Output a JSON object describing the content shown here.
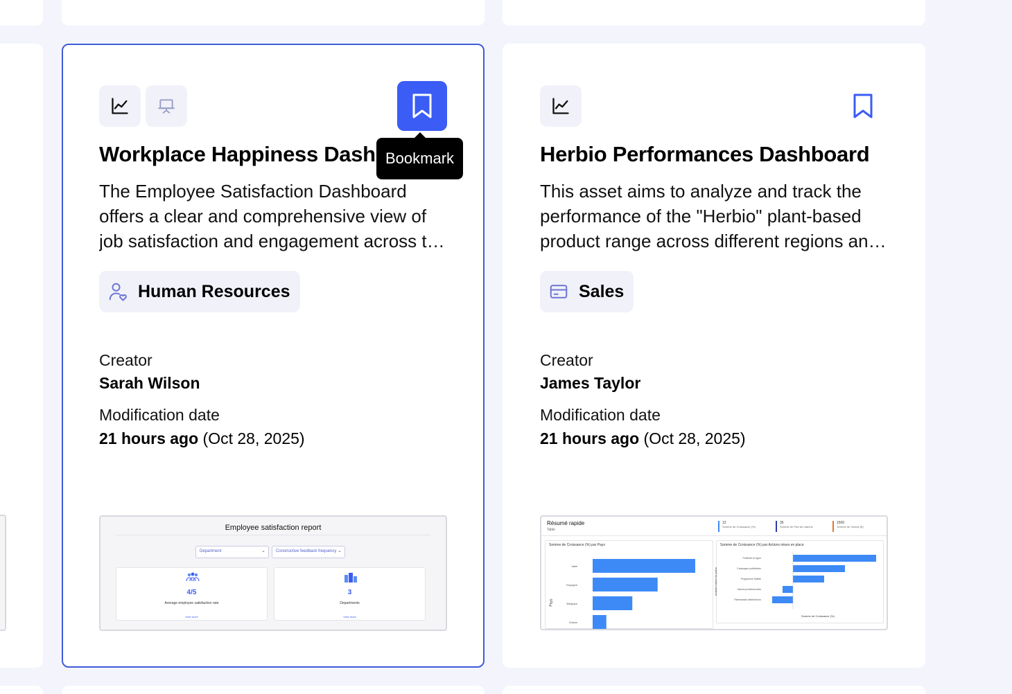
{
  "cards": [
    {
      "title": "Workplace Happiness Dashboard",
      "description": "The Employee Satisfaction Dashboard offers a clear and comprehensive view of job satisfaction and engagement across the organization.",
      "tag": "Human Resources",
      "creator_label": "Creator",
      "creator": "Sarah Wilson",
      "date_label": "Modification date",
      "date_relative": "21 hours ago",
      "date_absolute": "(Oct 28, 2025)",
      "bookmark_active": true,
      "tooltip": "Bookmark",
      "preview": {
        "title": "Employee satisfaction report",
        "filter1": "Department",
        "filter2": "Constructive feedback frequency",
        "kpi1_value": "4/5",
        "kpi1_label": "Average employee satisfaction rate",
        "kpi1_link": "View more",
        "kpi2_value": "3",
        "kpi2_label": "Departments",
        "kpi2_link": "View more"
      }
    },
    {
      "title": "Herbio Performances Dashboard",
      "description": "This asset aims to analyze and track the performance of the \"Herbio\" plant-based product range across different regions and channels.",
      "tag": "Sales",
      "creator_label": "Creator",
      "creator": "James Taylor",
      "date_label": "Modification date",
      "date_relative": "21 hours ago",
      "date_absolute": "(Oct 28, 2025)",
      "bookmark_active": false,
      "preview": {
        "title": "Résumé rapide",
        "subtitle": "Table",
        "kpi1_value": "12",
        "kpi1_label": "Somme de Croissance (%)",
        "kpi2_value": "35",
        "kpi2_label": "Somme de Part de marché",
        "kpi3_value": "1500",
        "kpi3_label": "Somme de Ventes (€)",
        "chart1_title": "Somme de Croissance (%) par Pays",
        "chart1_axis": "Pays",
        "chart1_categories": [
          "Italie",
          "Espagne",
          "Belgique",
          "Suisse"
        ],
        "chart1_values": [
          15,
          9.5,
          5.8,
          2
        ],
        "chart2_title": "Somme de Croissance (%) par Actions mises en place",
        "chart2_axis": "Actions mises en place",
        "chart2_xlabel": "Somme de Croissance (%)",
        "chart2_categories": [
          "Publicité en ligne",
          "Campagne publicitaire",
          "Programme fidélité",
          "Salons professionnels",
          "Partenariats distributeurs"
        ],
        "chart2_values": [
          12,
          7.5,
          4.5,
          -1.5,
          -3
        ]
      }
    }
  ],
  "colors": {
    "accent": "#3b5cf5",
    "selected_border": "#3f5bd8",
    "bar": "#3d8af7"
  }
}
